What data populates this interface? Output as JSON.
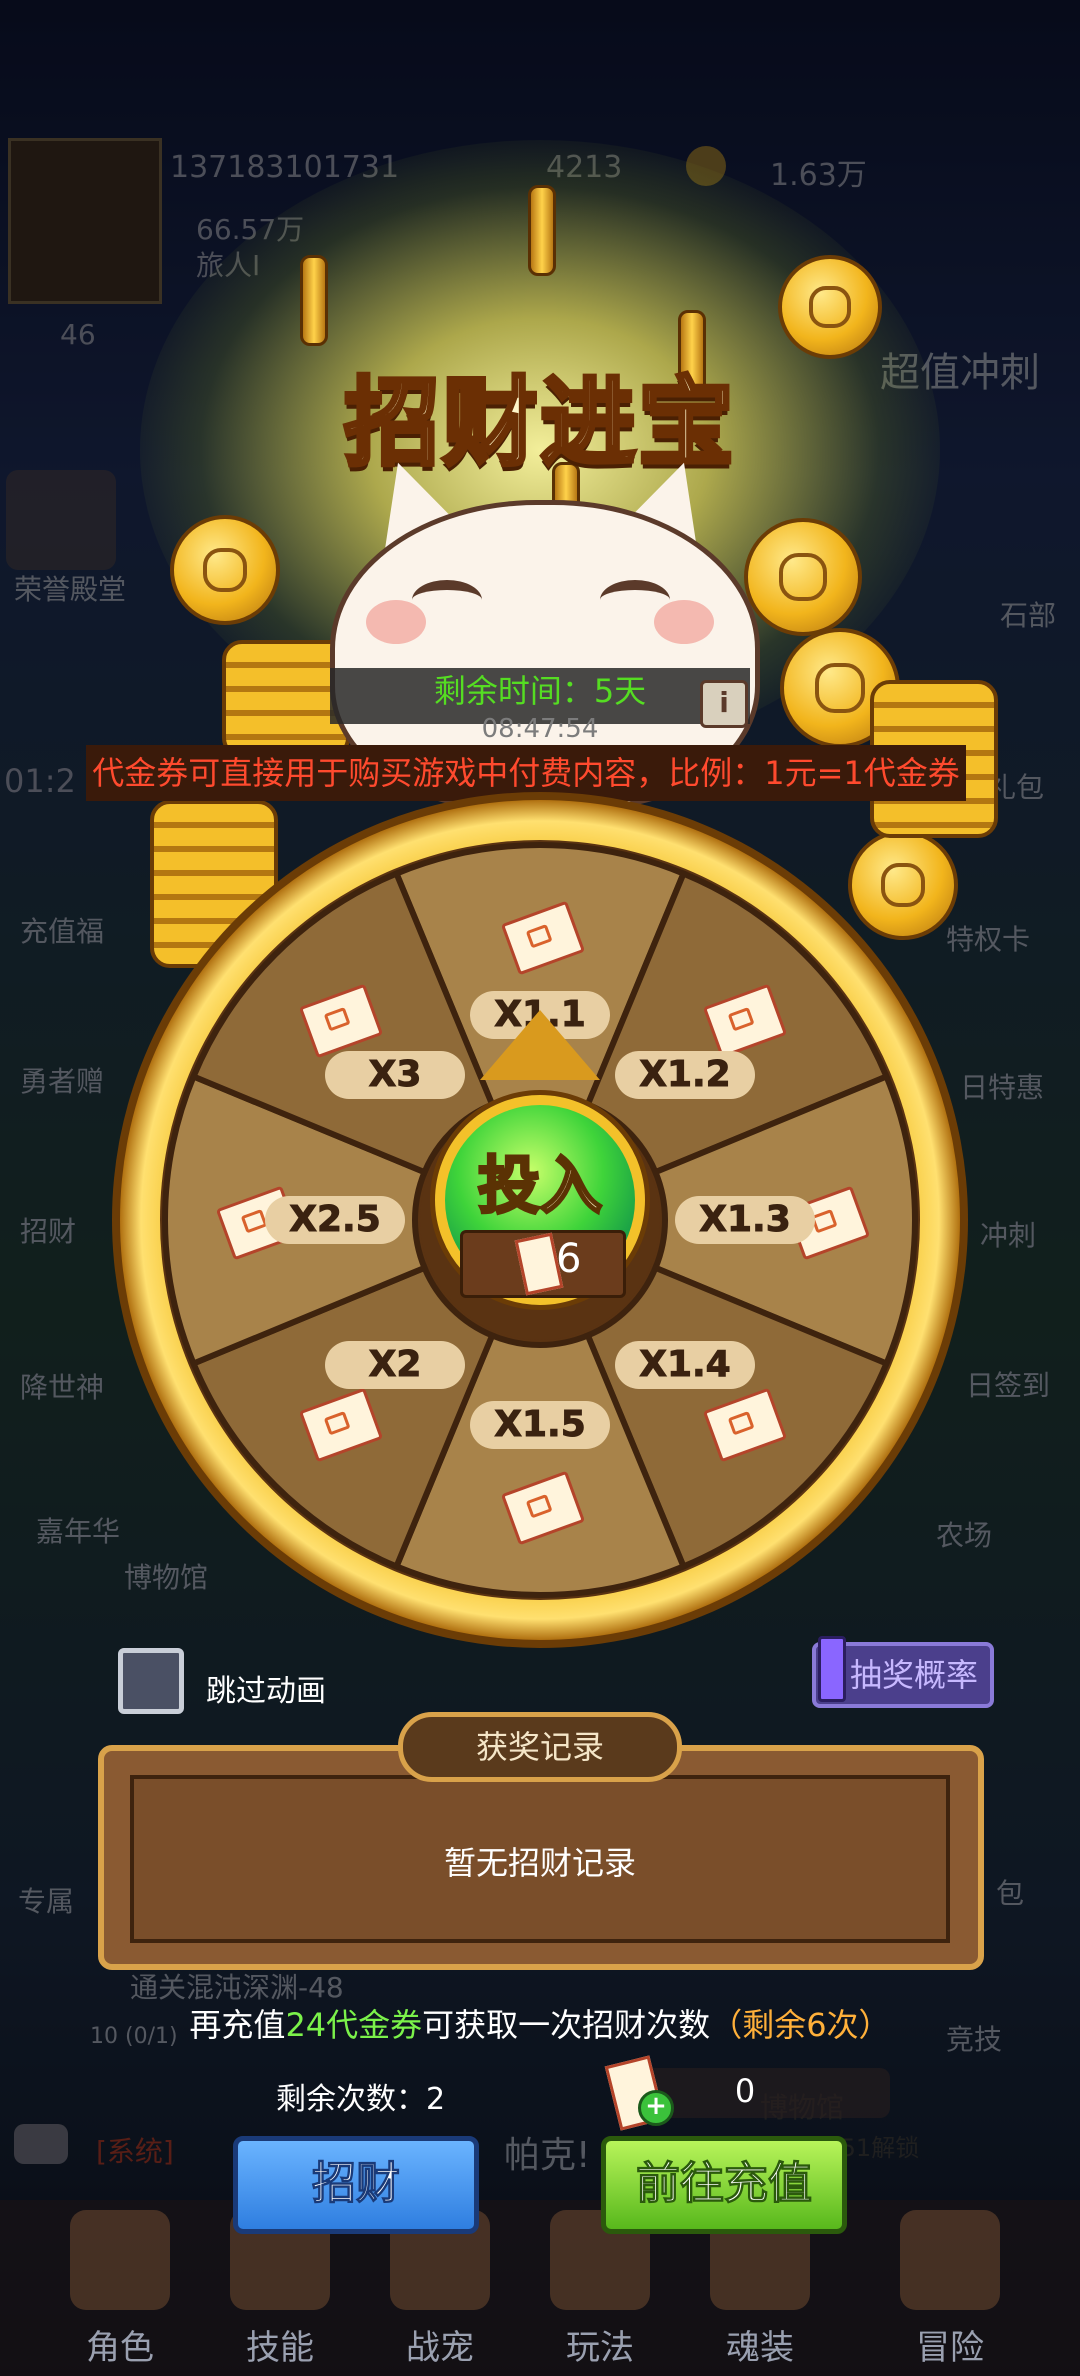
{
  "background": {
    "player_id": "137183101731",
    "gems": "4213",
    "gold": "1.63万",
    "power": "66.57万",
    "player_title": "旅人I",
    "level": "46",
    "timer_partial": "01:2",
    "left_menu": [
      "荣誉殿堂",
      "充值福",
      "勇者赠",
      "招财",
      "降世神",
      "嘉年华",
      "专属"
    ],
    "right_menu": [
      "超值冲刺",
      "石部",
      "充礼包",
      "特权卡",
      "日特惠",
      "冲刺",
      "日签到",
      "农场",
      "包",
      "竞技"
    ],
    "museum": "博物馆",
    "dungeon_text": "通关混沌深渊-48",
    "dungeon_progress": "10 (0/1)",
    "chat_tag": "[系统]",
    "chat_name": "帕克!",
    "unlock_hint": "乱深渊-51解锁",
    "museum_right": "博物馆"
  },
  "event": {
    "title": "招财进宝",
    "remaining_time_label": "剩余时间：5天",
    "clock": "08:47:54",
    "info_icon": "info-icon",
    "notice": "代金券可直接用于购买游戏中付费内容，比例：1元=1代金券"
  },
  "wheel": {
    "segments": [
      "X1.1",
      "X1.2",
      "X1.3",
      "X1.4",
      "X1.5",
      "X2",
      "X2.5",
      "X3"
    ],
    "center_label": "投入",
    "cost": "6",
    "prize_icon": "voucher-icon"
  },
  "controls": {
    "skip_animation": "跳过动画",
    "probability": "抽奖概率"
  },
  "records": {
    "title": "获奖记录",
    "empty": "暂无招财记录"
  },
  "promo": {
    "prefix": "再充值",
    "amount": "24代金券",
    "middle": "可获取一次招财次数",
    "remaining": "（剩余6次）"
  },
  "remaining_count": "剩余次数：2",
  "voucher_count": "0",
  "buttons": {
    "spin": "招财",
    "recharge": "前往充值"
  },
  "bottom_nav": [
    "角色",
    "技能",
    "战宠",
    "玩法",
    "魂装",
    "冒险"
  ]
}
